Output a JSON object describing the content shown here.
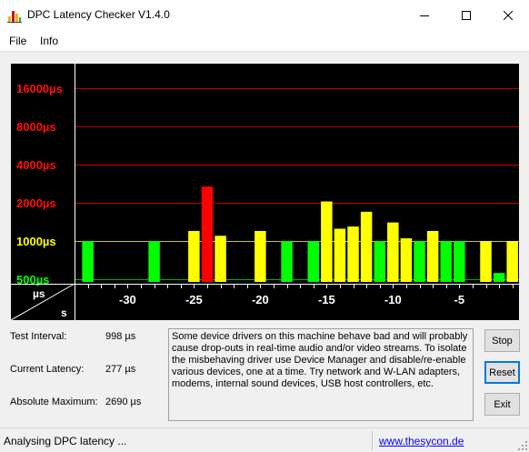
{
  "window": {
    "title": "DPC Latency Checker V1.4.0"
  },
  "menu": {
    "items": [
      "File",
      "Info"
    ]
  },
  "chart_data": {
    "type": "bar",
    "yticks": [
      "16000µs",
      "8000µs",
      "4000µs",
      "2000µs",
      "1000µs",
      "500µs"
    ],
    "ytick_colors": [
      "#ff1010",
      "#ff1010",
      "#ff1010",
      "#ff1010",
      "#ffff00",
      "#00ff00"
    ],
    "axis_corner_y_unit": "µs",
    "axis_corner_x_unit": "s",
    "xticks": [
      "-30",
      "-25",
      "-20",
      "-15",
      "-10",
      "-5"
    ],
    "xtick_values": [
      -30,
      -25,
      -20,
      -15,
      -10,
      -5
    ],
    "xlim": [
      -34,
      -0.5
    ],
    "ylim": [
      0,
      16000
    ],
    "scale": "log2",
    "bars": [
      {
        "t": -33,
        "value": 1000,
        "level": "green"
      },
      {
        "t": -32,
        "value": 50,
        "level": "green"
      },
      {
        "t": -31,
        "value": 50,
        "level": "green"
      },
      {
        "t": -30,
        "value": 50,
        "level": "green"
      },
      {
        "t": -29,
        "value": 50,
        "level": "green"
      },
      {
        "t": -28,
        "value": 1000,
        "level": "green"
      },
      {
        "t": -27,
        "value": 50,
        "level": "green"
      },
      {
        "t": -26,
        "value": 50,
        "level": "green"
      },
      {
        "t": -25,
        "value": 1200,
        "level": "yellow"
      },
      {
        "t": -24,
        "value": 2690,
        "level": "red"
      },
      {
        "t": -23,
        "value": 1100,
        "level": "yellow"
      },
      {
        "t": -22,
        "value": 50,
        "level": "green"
      },
      {
        "t": -21,
        "value": 50,
        "level": "green"
      },
      {
        "t": -20,
        "value": 1200,
        "level": "yellow"
      },
      {
        "t": -19,
        "value": 50,
        "level": "green"
      },
      {
        "t": -18,
        "value": 1000,
        "level": "green"
      },
      {
        "t": -17,
        "value": 50,
        "level": "green"
      },
      {
        "t": -16,
        "value": 1000,
        "level": "green"
      },
      {
        "t": -15,
        "value": 2050,
        "level": "yellow"
      },
      {
        "t": -14,
        "value": 1250,
        "level": "yellow"
      },
      {
        "t": -13,
        "value": 1300,
        "level": "yellow"
      },
      {
        "t": -12,
        "value": 1700,
        "level": "yellow"
      },
      {
        "t": -11,
        "value": 1000,
        "level": "green"
      },
      {
        "t": -10,
        "value": 1400,
        "level": "yellow"
      },
      {
        "t": -9,
        "value": 1050,
        "level": "yellow"
      },
      {
        "t": -8,
        "value": 1000,
        "level": "green"
      },
      {
        "t": -7,
        "value": 1200,
        "level": "yellow"
      },
      {
        "t": -6,
        "value": 1000,
        "level": "green"
      },
      {
        "t": -5,
        "value": 1000,
        "level": "green"
      },
      {
        "t": -4,
        "value": 440,
        "level": "green"
      },
      {
        "t": -3,
        "value": 1000,
        "level": "yellow"
      },
      {
        "t": -2,
        "value": 560,
        "level": "green"
      },
      {
        "t": -1,
        "value": 1000,
        "level": "yellow"
      }
    ],
    "level_colors": {
      "green": "#00ff00",
      "yellow": "#ffff00",
      "red": "#ff0000"
    },
    "gridline_colors": {
      "red": "#c00000",
      "yellow": "#c8c800",
      "green": "#00b000"
    }
  },
  "info": {
    "test_interval_label": "Test Interval:",
    "test_interval_value": "998 µs",
    "current_latency_label": "Current Latency:",
    "current_latency_value": "277 µs",
    "absolute_maximum_label": "Absolute Maximum:",
    "absolute_maximum_value": "2690 µs"
  },
  "message": "Some device drivers on this machine behave bad and will probably cause drop-outs in real-time audio and/or video streams. To isolate the misbehaving driver use Device Manager and disable/re-enable various devices, one at a time. Try network and W-LAN adapters, modems, internal sound devices, USB host controllers, etc.",
  "buttons": {
    "stop": "Stop",
    "reset": "Reset",
    "exit": "Exit"
  },
  "status": {
    "text": "Analysing DPC latency ...",
    "link": "www.thesycon.de"
  }
}
